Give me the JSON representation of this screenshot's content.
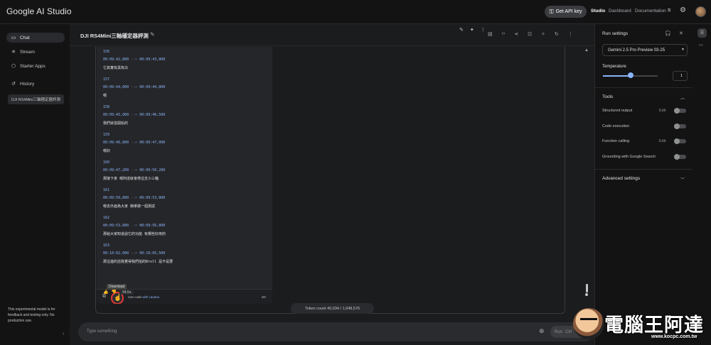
{
  "app": {
    "title": "Google AI Studio",
    "api_button": "Get API key",
    "nav": [
      "Studio",
      "Dashboard",
      "Documentation"
    ]
  },
  "sidebar": {
    "items": [
      {
        "label": "Chat",
        "icon": "chat-icon",
        "active": true
      },
      {
        "label": "Stream",
        "icon": "stream-icon"
      },
      {
        "label": "Starter Apps",
        "icon": "apps-icon"
      },
      {
        "label": "History",
        "icon": "history-icon"
      }
    ],
    "history_item": "DJI RS4Mini三軸穩定器評測",
    "note": "This experimental model is for feedback and testing only. No production use."
  },
  "chat": {
    "title": "DJI RS4Mini三軸穩定器評測",
    "subtitles": [
      {
        "idx": "156",
        "start": "00:09:42,800",
        "end": "00:09:43,800",
        "text": "它其實有黑有白"
      },
      {
        "idx": "157",
        "start": "00:09:44,000",
        "end": "00:09:44,800",
        "text": "嗯"
      },
      {
        "idx": "158",
        "start": "00:09:45,000",
        "end": "00:09:46,500",
        "text": "我們就從開始的"
      },
      {
        "idx": "159",
        "start": "00:09:46,800",
        "end": "00:09:47,000",
        "text": "嗯好"
      },
      {
        "idx": "160",
        "start": "00:09:47,200",
        "end": "00:09:50,200",
        "text": "那接下來 嗯阿達就會帶這支小三軸"
      },
      {
        "idx": "161",
        "start": "00:09:50,800",
        "end": "00:09:53,800",
        "text": "嗯去外面為大家 簡單做一個測試"
      },
      {
        "idx": "162",
        "start": "00:09:53,800",
        "end": "00:09:56,800",
        "text": "那給大家知道說它的功能 有哪些好用的"
      },
      {
        "idx": "163",
        "start": "00:10:02,000",
        "end": "00:10:05,500",
        "text": "那這邊的話我覺得我們拍的Broll 是不是要"
      }
    ],
    "arrow": "-->",
    "caution_prefix": "Use code",
    "caution_link": "with caution.",
    "code_lang": "Srt",
    "tooltip": "Download",
    "response_time": "94.5s",
    "token_count": "Token count 40,034 / 1,048,576"
  },
  "prompt": {
    "placeholder": "Type something",
    "run_label": "Run",
    "run_shortcut": "Ctrl"
  },
  "run_settings": {
    "title": "Run settings",
    "model": "Gemini 2.5 Pro Preview 03-25",
    "temperature_label": "Temperature",
    "temperature_value": "1",
    "temperature_fraction": 0.5,
    "tools_label": "Tools",
    "tools": [
      {
        "label": "Structured output",
        "edit": "Edit"
      },
      {
        "label": "Code execution",
        "edit": ""
      },
      {
        "label": "Function calling",
        "edit": "Edit"
      },
      {
        "label": "Grounding with Google Search",
        "edit": ""
      }
    ],
    "advanced_label": "Advanced settings"
  },
  "watermark": {
    "text": "電腦王阿達",
    "url": "www.kocpc.com.tw"
  }
}
